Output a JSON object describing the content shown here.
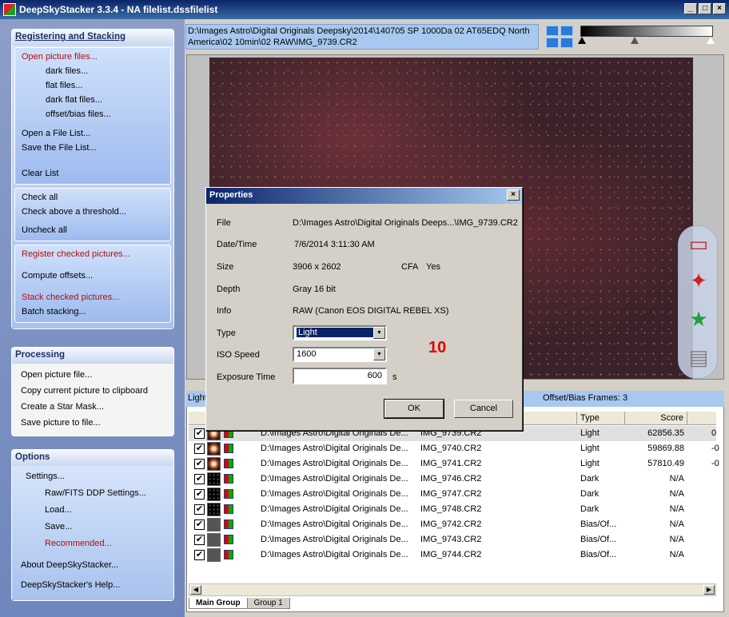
{
  "window": {
    "title": "DeepSkyStacker 3.3.4 - NA filelist.dssfilelist"
  },
  "sidebar": {
    "register": {
      "header": "Registering and Stacking",
      "open_pictures": "Open picture files...",
      "dark": "dark files...",
      "flat": "flat files...",
      "dark_flat": "dark flat files...",
      "offset_bias": "offset/bias files...",
      "open_list": "Open a File List...",
      "save_list": "Save the File List...",
      "clear_list": "Clear List",
      "check_all": "Check all",
      "check_threshold": "Check above a threshold...",
      "uncheck_all": "Uncheck all",
      "register_checked": "Register checked pictures...",
      "compute_offsets": "Compute offsets...",
      "stack_checked": "Stack checked pictures...",
      "batch": "Batch stacking..."
    },
    "processing": {
      "header": "Processing",
      "open_picture": "Open picture file...",
      "copy": "Copy current picture to clipboard",
      "star_mask": "Create a Star Mask...",
      "save_picture": "Save picture to file..."
    },
    "options": {
      "header": "Options",
      "settings": "Settings...",
      "raw_fits": "Raw/FITS DDP Settings...",
      "load": "Load...",
      "save": "Save...",
      "recommended": "Recommended...",
      "about": "About DeepSkyStacker...",
      "help": "DeepSkyStacker's Help..."
    }
  },
  "path_display": "D:\\Images Astro\\Digital Originals Deepsky\\2014\\140705 SP 1000Da 02 AT65EDQ North America\\02 10min\\02 RAW\\IMG_9739.CR2",
  "list": {
    "summary_left": "Light",
    "summary_right": "Offset/Bias Frames: 3",
    "col_type": "Type",
    "col_score": "Score",
    "rows": [
      {
        "path": "D:\\Images Astro\\Digital Originals De...",
        "file": "IMG_9739.CR2",
        "type": "Light",
        "score": "62856.35",
        "extra": "0",
        "thumb": "light"
      },
      {
        "path": "D:\\Images Astro\\Digital Originals De...",
        "file": "IMG_9740.CR2",
        "type": "Light",
        "score": "59869.88",
        "extra": "-0",
        "thumb": "light"
      },
      {
        "path": "D:\\Images Astro\\Digital Originals De...",
        "file": "IMG_9741.CR2",
        "type": "Light",
        "score": "57810.49",
        "extra": "-0",
        "thumb": "light"
      },
      {
        "path": "D:\\Images Astro\\Digital Originals De...",
        "file": "IMG_9746.CR2",
        "type": "Dark",
        "score": "N/A",
        "extra": "",
        "thumb": "dark"
      },
      {
        "path": "D:\\Images Astro\\Digital Originals De...",
        "file": "IMG_9747.CR2",
        "type": "Dark",
        "score": "N/A",
        "extra": "",
        "thumb": "dark"
      },
      {
        "path": "D:\\Images Astro\\Digital Originals De...",
        "file": "IMG_9748.CR2",
        "type": "Dark",
        "score": "N/A",
        "extra": "",
        "thumb": "dark"
      },
      {
        "path": "D:\\Images Astro\\Digital Originals De...",
        "file": "IMG_9742.CR2",
        "type": "Bias/Of...",
        "score": "N/A",
        "extra": "",
        "thumb": "bias"
      },
      {
        "path": "D:\\Images Astro\\Digital Originals De...",
        "file": "IMG_9743.CR2",
        "type": "Bias/Of...",
        "score": "N/A",
        "extra": "",
        "thumb": "bias"
      },
      {
        "path": "D:\\Images Astro\\Digital Originals De...",
        "file": "IMG_9744.CR2",
        "type": "Bias/Of...",
        "score": "N/A",
        "extra": "",
        "thumb": "bias"
      }
    ]
  },
  "tabs": [
    "Main Group",
    "Group 1"
  ],
  "dialog": {
    "title": "Properties",
    "file_label": "File",
    "file_value": "D:\\Images Astro\\Digital Originals Deeps...\\IMG_9739.CR2",
    "datetime_label": "Date/Time",
    "datetime_value": "7/6/2014 3:11:30 AM",
    "size_label": "Size",
    "size_value": "3906 x 2602",
    "cfa_label": "CFA",
    "cfa_value": "Yes",
    "depth_label": "Depth",
    "depth_value": "Gray 16 bit",
    "info_label": "Info",
    "info_value": "RAW (Canon EOS DIGITAL REBEL XS)",
    "type_label": "Type",
    "type_value": "Light",
    "iso_label": "ISO Speed",
    "iso_value": "1600",
    "exposure_label": "Exposure Time",
    "exposure_value": "600",
    "exposure_unit": "s",
    "ok": "OK",
    "cancel": "Cancel",
    "annotation": "10"
  }
}
